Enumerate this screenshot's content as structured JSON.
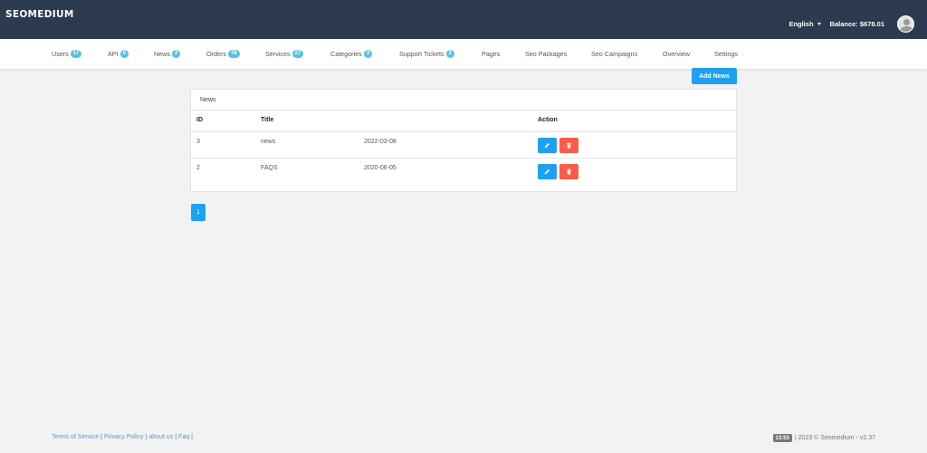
{
  "header": {
    "brand": "SEOMEDIUM",
    "language": "English",
    "balance": "Balance: $678.01"
  },
  "nav": {
    "items": [
      {
        "label": "Users",
        "badge": "17"
      },
      {
        "label": "API",
        "badge": "0"
      },
      {
        "label": "News",
        "badge": "2"
      },
      {
        "label": "Orders",
        "badge": "76"
      },
      {
        "label": "Services",
        "badge": "27"
      },
      {
        "label": "Categories",
        "badge": "3"
      },
      {
        "label": "Support Tickets",
        "badge": "3"
      },
      {
        "label": "Pages",
        "badge": null
      },
      {
        "label": "Seo Packages",
        "badge": null
      },
      {
        "label": "Seo Campaigns",
        "badge": null
      },
      {
        "label": "Overview",
        "badge": null
      },
      {
        "label": "Settings",
        "badge": null
      }
    ]
  },
  "actions": {
    "add_news": "Add News"
  },
  "panel": {
    "title": "News",
    "columns": {
      "id": "ID",
      "title": "Title",
      "action": "Action"
    },
    "rows": [
      {
        "id": "3",
        "title": "news",
        "date": "2022-03-08"
      },
      {
        "id": "2",
        "title": "FAQS",
        "date": "2020-06-05"
      }
    ]
  },
  "pagination": {
    "current_page": "1"
  },
  "footer": {
    "links": [
      "Terms of Service",
      "Privacy Policy",
      "about us",
      "Faq"
    ],
    "time": "13:53",
    "copyright": "| 2023 © Seomedium - v2.37"
  },
  "colors": {
    "topbar": "#2b3a4e",
    "primary": "#1ea1f2",
    "danger": "#ff5b4a",
    "badge": "#5bc0de"
  },
  "icons": {
    "edit": "pencil-icon",
    "delete": "trash-icon",
    "caret": "caret-down-icon",
    "avatar": "user-avatar-icon"
  }
}
